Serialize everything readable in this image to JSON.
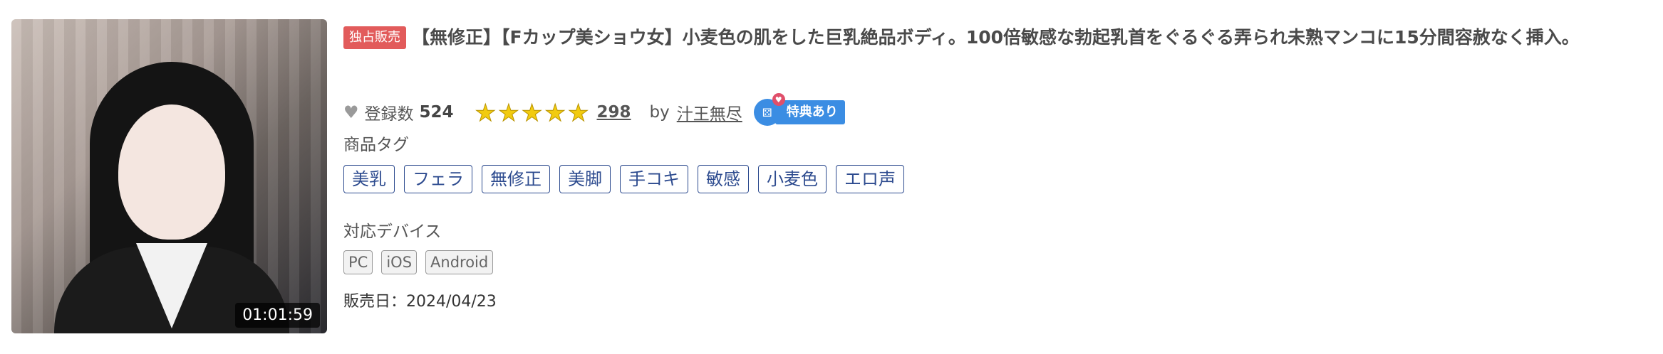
{
  "thumbnail": {
    "duration": "01:01:59"
  },
  "product": {
    "badge": "独占販売",
    "title": "【無修正】【Fカップ美ショウ女】小麦色の肌をした巨乳絶品ボディ。100倍敏感な勃起乳首をぐるぐる弄られ未熟マンコに15分間容赦なく挿入。"
  },
  "meta": {
    "favorite_label": "登録数",
    "favorite_count": "524",
    "rating_stars": 5,
    "review_count": "298",
    "by_label": "by",
    "author": "汁王無尽",
    "bonus_icon_text": "⚄",
    "bonus_label": "特典あり"
  },
  "tags_section": {
    "label": "商品タグ",
    "tags": [
      "美乳",
      "フェラ",
      "無修正",
      "美脚",
      "手コキ",
      "敏感",
      "小麦色",
      "エロ声"
    ]
  },
  "devices_section": {
    "label": "対応デバイス",
    "devices": [
      "PC",
      "iOS",
      "Android"
    ]
  },
  "release": "販売日：2024/04/23",
  "colors": {
    "badge": "#e25b5b",
    "star": "#f2cb10",
    "tag": "#2d4b8f",
    "bonus": "#3b8de3"
  }
}
